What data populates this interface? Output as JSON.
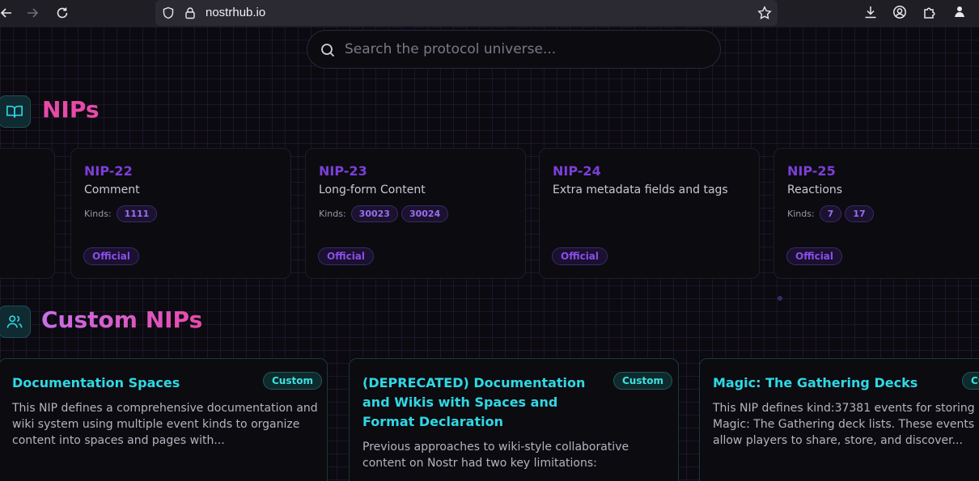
{
  "browser": {
    "url": "nostrhub.io"
  },
  "search": {
    "placeholder": "Search the protocol universe..."
  },
  "sections": {
    "nips_title": "NIPs",
    "custom_title": "Custom NIPs"
  },
  "nips": [
    {
      "id": "NIP-22",
      "name": "Comment",
      "kinds_label": "Kinds:",
      "kinds": [
        "1111"
      ],
      "badge": "Official"
    },
    {
      "id": "NIP-23",
      "name": "Long-form Content",
      "kinds_label": "Kinds:",
      "kinds": [
        "30023",
        "30024"
      ],
      "badge": "Official"
    },
    {
      "id": "NIP-24",
      "name": "Extra metadata fields and tags",
      "kinds_label": "",
      "kinds": [],
      "badge": "Official"
    },
    {
      "id": "NIP-25",
      "name": "Reactions",
      "kinds_label": "Kinds:",
      "kinds": [
        "7",
        "17"
      ],
      "badge": "Official"
    }
  ],
  "custom_nips": [
    {
      "title": "Documentation Spaces",
      "badge": "Custom",
      "description": "This NIP defines a comprehensive documentation and wiki system using multiple event kinds to organize content into spaces and pages with..."
    },
    {
      "title": "(DEPRECATED) Documentation and Wikis with Spaces and Format Declaration",
      "badge": "Custom",
      "description": "Previous approaches to wiki-style collaborative content on Nostr had two key limitations:"
    },
    {
      "title": "Magic: The Gathering Decks",
      "badge": "Custom",
      "description": "This NIP defines kind:37381 events for storing Magic: The Gathering deck lists. These events allow players to share, store, and discover..."
    }
  ],
  "colors": {
    "nip_accent": "#7b3fd8",
    "custom_accent": "#2fd8e4",
    "title_pink": "#e84aa8"
  }
}
